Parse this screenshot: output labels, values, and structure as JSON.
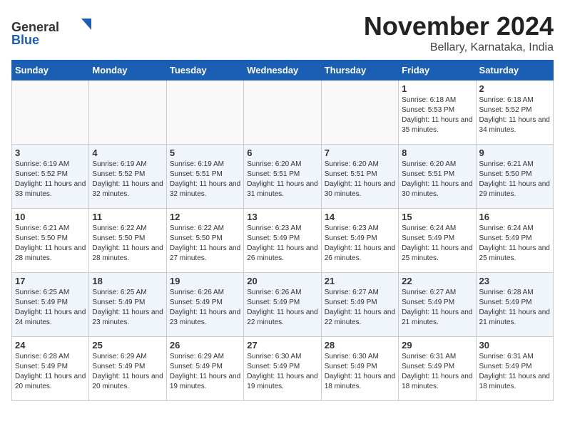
{
  "header": {
    "logo_general": "General",
    "logo_blue": "Blue",
    "month": "November 2024",
    "location": "Bellary, Karnataka, India"
  },
  "weekdays": [
    "Sunday",
    "Monday",
    "Tuesday",
    "Wednesday",
    "Thursday",
    "Friday",
    "Saturday"
  ],
  "weeks": [
    [
      {
        "day": "",
        "info": ""
      },
      {
        "day": "",
        "info": ""
      },
      {
        "day": "",
        "info": ""
      },
      {
        "day": "",
        "info": ""
      },
      {
        "day": "",
        "info": ""
      },
      {
        "day": "1",
        "info": "Sunrise: 6:18 AM\nSunset: 5:53 PM\nDaylight: 11 hours and 35 minutes."
      },
      {
        "day": "2",
        "info": "Sunrise: 6:18 AM\nSunset: 5:52 PM\nDaylight: 11 hours and 34 minutes."
      }
    ],
    [
      {
        "day": "3",
        "info": "Sunrise: 6:19 AM\nSunset: 5:52 PM\nDaylight: 11 hours and 33 minutes."
      },
      {
        "day": "4",
        "info": "Sunrise: 6:19 AM\nSunset: 5:52 PM\nDaylight: 11 hours and 32 minutes."
      },
      {
        "day": "5",
        "info": "Sunrise: 6:19 AM\nSunset: 5:51 PM\nDaylight: 11 hours and 32 minutes."
      },
      {
        "day": "6",
        "info": "Sunrise: 6:20 AM\nSunset: 5:51 PM\nDaylight: 11 hours and 31 minutes."
      },
      {
        "day": "7",
        "info": "Sunrise: 6:20 AM\nSunset: 5:51 PM\nDaylight: 11 hours and 30 minutes."
      },
      {
        "day": "8",
        "info": "Sunrise: 6:20 AM\nSunset: 5:51 PM\nDaylight: 11 hours and 30 minutes."
      },
      {
        "day": "9",
        "info": "Sunrise: 6:21 AM\nSunset: 5:50 PM\nDaylight: 11 hours and 29 minutes."
      }
    ],
    [
      {
        "day": "10",
        "info": "Sunrise: 6:21 AM\nSunset: 5:50 PM\nDaylight: 11 hours and 28 minutes."
      },
      {
        "day": "11",
        "info": "Sunrise: 6:22 AM\nSunset: 5:50 PM\nDaylight: 11 hours and 28 minutes."
      },
      {
        "day": "12",
        "info": "Sunrise: 6:22 AM\nSunset: 5:50 PM\nDaylight: 11 hours and 27 minutes."
      },
      {
        "day": "13",
        "info": "Sunrise: 6:23 AM\nSunset: 5:49 PM\nDaylight: 11 hours and 26 minutes."
      },
      {
        "day": "14",
        "info": "Sunrise: 6:23 AM\nSunset: 5:49 PM\nDaylight: 11 hours and 26 minutes."
      },
      {
        "day": "15",
        "info": "Sunrise: 6:24 AM\nSunset: 5:49 PM\nDaylight: 11 hours and 25 minutes."
      },
      {
        "day": "16",
        "info": "Sunrise: 6:24 AM\nSunset: 5:49 PM\nDaylight: 11 hours and 25 minutes."
      }
    ],
    [
      {
        "day": "17",
        "info": "Sunrise: 6:25 AM\nSunset: 5:49 PM\nDaylight: 11 hours and 24 minutes."
      },
      {
        "day": "18",
        "info": "Sunrise: 6:25 AM\nSunset: 5:49 PM\nDaylight: 11 hours and 23 minutes."
      },
      {
        "day": "19",
        "info": "Sunrise: 6:26 AM\nSunset: 5:49 PM\nDaylight: 11 hours and 23 minutes."
      },
      {
        "day": "20",
        "info": "Sunrise: 6:26 AM\nSunset: 5:49 PM\nDaylight: 11 hours and 22 minutes."
      },
      {
        "day": "21",
        "info": "Sunrise: 6:27 AM\nSunset: 5:49 PM\nDaylight: 11 hours and 22 minutes."
      },
      {
        "day": "22",
        "info": "Sunrise: 6:27 AM\nSunset: 5:49 PM\nDaylight: 11 hours and 21 minutes."
      },
      {
        "day": "23",
        "info": "Sunrise: 6:28 AM\nSunset: 5:49 PM\nDaylight: 11 hours and 21 minutes."
      }
    ],
    [
      {
        "day": "24",
        "info": "Sunrise: 6:28 AM\nSunset: 5:49 PM\nDaylight: 11 hours and 20 minutes."
      },
      {
        "day": "25",
        "info": "Sunrise: 6:29 AM\nSunset: 5:49 PM\nDaylight: 11 hours and 20 minutes."
      },
      {
        "day": "26",
        "info": "Sunrise: 6:29 AM\nSunset: 5:49 PM\nDaylight: 11 hours and 19 minutes."
      },
      {
        "day": "27",
        "info": "Sunrise: 6:30 AM\nSunset: 5:49 PM\nDaylight: 11 hours and 19 minutes."
      },
      {
        "day": "28",
        "info": "Sunrise: 6:30 AM\nSunset: 5:49 PM\nDaylight: 11 hours and 18 minutes."
      },
      {
        "day": "29",
        "info": "Sunrise: 6:31 AM\nSunset: 5:49 PM\nDaylight: 11 hours and 18 minutes."
      },
      {
        "day": "30",
        "info": "Sunrise: 6:31 AM\nSunset: 5:49 PM\nDaylight: 11 hours and 18 minutes."
      }
    ]
  ]
}
